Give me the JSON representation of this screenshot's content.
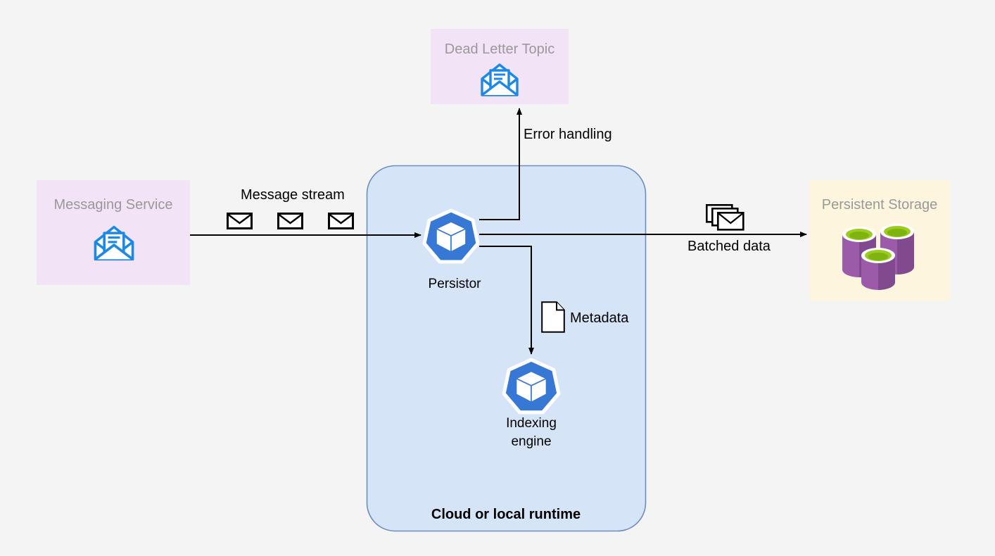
{
  "diagram": {
    "background_color": "#f4f4f4",
    "title_hidden": "",
    "nodes": {
      "dead_letter_topic": {
        "label": "Dead Letter Topic",
        "icon": "open-envelope-icon",
        "fill": "#f3e3f7",
        "text_color": "#9b9b9b"
      },
      "messaging_service": {
        "label": "Messaging Service",
        "icon": "open-envelope-icon",
        "fill": "#f3e3f7",
        "text_color": "#9b9b9b"
      },
      "persistent_storage": {
        "label": "Persistent Storage",
        "icon": "database-cylinders-icon",
        "fill": "#fdf5dd",
        "text_color": "#9b9b9b"
      },
      "runtime_container": {
        "label": "Cloud or local runtime",
        "fill": "#d6e4f7",
        "border": "#6c8ebf",
        "text_color": "#000000"
      },
      "persistor": {
        "label": "Persistor",
        "icon": "kubernetes-pod-icon",
        "accent": "#3778d4"
      },
      "indexing_engine": {
        "label_line1": "Indexing",
        "label_line2": "engine",
        "icon": "kubernetes-pod-icon",
        "accent": "#3778d4"
      }
    },
    "edges": {
      "message_stream": {
        "label": "Message stream",
        "icon": "envelope-icon",
        "envelope_count": 3
      },
      "error_handling": {
        "label": "Error handling"
      },
      "metadata": {
        "label": "Metadata",
        "icon": "document-icon"
      },
      "batched_data": {
        "label": "Batched data",
        "icon": "stacked-envelopes-icon"
      }
    }
  }
}
